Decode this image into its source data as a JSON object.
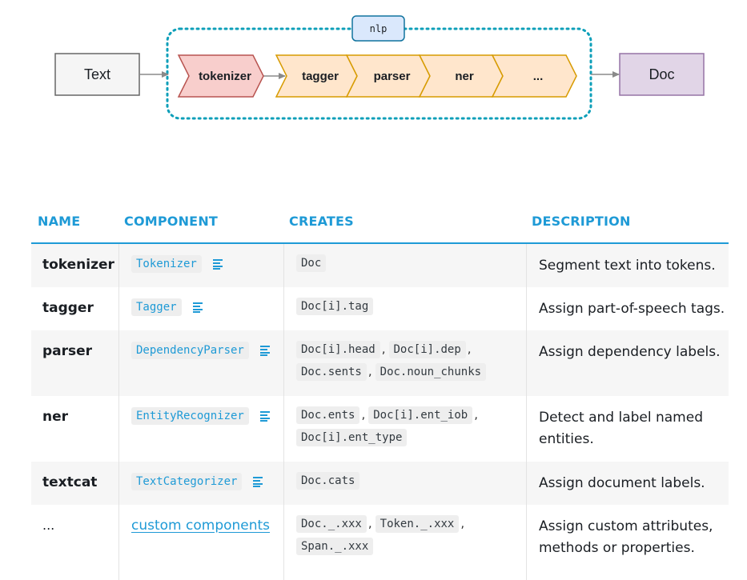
{
  "diagram": {
    "input_label": "Text",
    "nlp_label": "nlp",
    "tokenizer_label": "tokenizer",
    "pipes": [
      "tagger",
      "parser",
      "ner",
      "..."
    ],
    "output_label": "Doc",
    "colors": {
      "input_fill": "#f5f5f5",
      "input_stroke": "#666666",
      "tokenizer_fill": "#f8cecc",
      "tokenizer_stroke": "#b85450",
      "pipe_fill": "#ffe6cc",
      "pipe_stroke": "#d79b00",
      "output_fill": "#e1d5e7",
      "output_stroke": "#9673a6",
      "nlp_fill": "#dae8fc",
      "nlp_stroke": "#10739e",
      "border": "#0e9fb9"
    }
  },
  "table": {
    "headers": [
      "NAME",
      "COMPONENT",
      "CREATES",
      "DESCRIPTION"
    ],
    "rows": [
      {
        "name": "tokenizer",
        "component": "Tokenizer",
        "creates1": [
          "Doc"
        ],
        "creates2": [],
        "description": "Segment text into tokens."
      },
      {
        "name": "tagger",
        "component": "Tagger",
        "creates1": [
          "Doc[i].tag"
        ],
        "creates2": [],
        "description": "Assign part-of-speech tags."
      },
      {
        "name": "parser",
        "component": "DependencyParser",
        "creates1": [
          "Doc[i].head",
          "Doc[i].dep"
        ],
        "creates2": [
          "Doc.sents",
          "Doc.noun_chunks"
        ],
        "description": "Assign dependency labels."
      },
      {
        "name": "ner",
        "component": "EntityRecognizer",
        "creates1": [
          "Doc.ents",
          "Doc[i].ent_iob"
        ],
        "creates2": [
          "Doc[i].ent_type"
        ],
        "description": "Detect and label named entities."
      },
      {
        "name": "textcat",
        "component": "TextCategorizer",
        "creates1": [
          "Doc.cats"
        ],
        "creates2": [],
        "description": "Assign document labels."
      },
      {
        "name": "...",
        "component": "custom components",
        "creates1": [
          "Doc._.xxx",
          "Token._.xxx"
        ],
        "creates2": [
          "Span._.xxx"
        ],
        "description": "Assign custom attributes, methods or properties."
      }
    ]
  }
}
